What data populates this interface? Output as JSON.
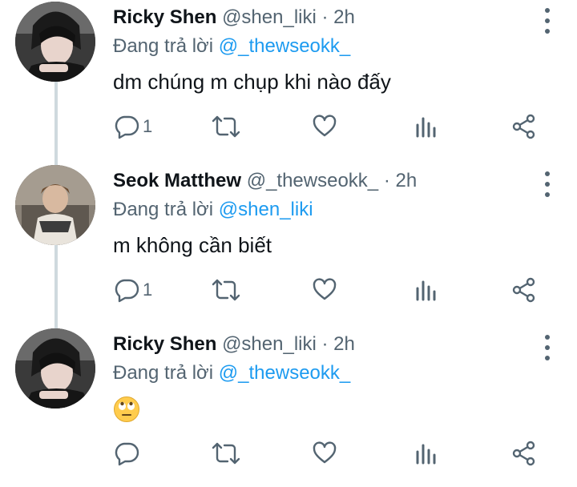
{
  "colors": {
    "text": "#0f1419",
    "secondary": "#536471",
    "link": "#1d9bf0",
    "thread_line": "#cfd9de"
  },
  "tweets": [
    {
      "display_name": "Ricky Shen",
      "handle": "@shen_liki",
      "separator": "·",
      "time": "2h",
      "reply_prefix": "Đang trả lời",
      "reply_to": "@_thewseokk_",
      "text": "dm chúng m chụp khi nào đấy",
      "reply_count": "1",
      "avatar": "avatar-ricky"
    },
    {
      "display_name": "Seok Matthew",
      "handle": "@_thewseokk_",
      "separator": "·",
      "time": "2h",
      "reply_prefix": "Đang trả lời",
      "reply_to": "@shen_liki",
      "text": "m không cần biết",
      "reply_count": "1",
      "avatar": "avatar-seok"
    },
    {
      "display_name": "Ricky Shen",
      "handle": "@shen_liki",
      "separator": "·",
      "time": "2h",
      "reply_prefix": "Đang trả lời",
      "reply_to": "@_thewseokk_",
      "emoji": "face-with-rolling-eyes",
      "reply_count": "",
      "avatar": "avatar-ricky"
    }
  ],
  "icons": [
    "reply-icon",
    "retweet-icon",
    "like-icon",
    "analytics-icon",
    "share-icon",
    "more-options-icon"
  ]
}
